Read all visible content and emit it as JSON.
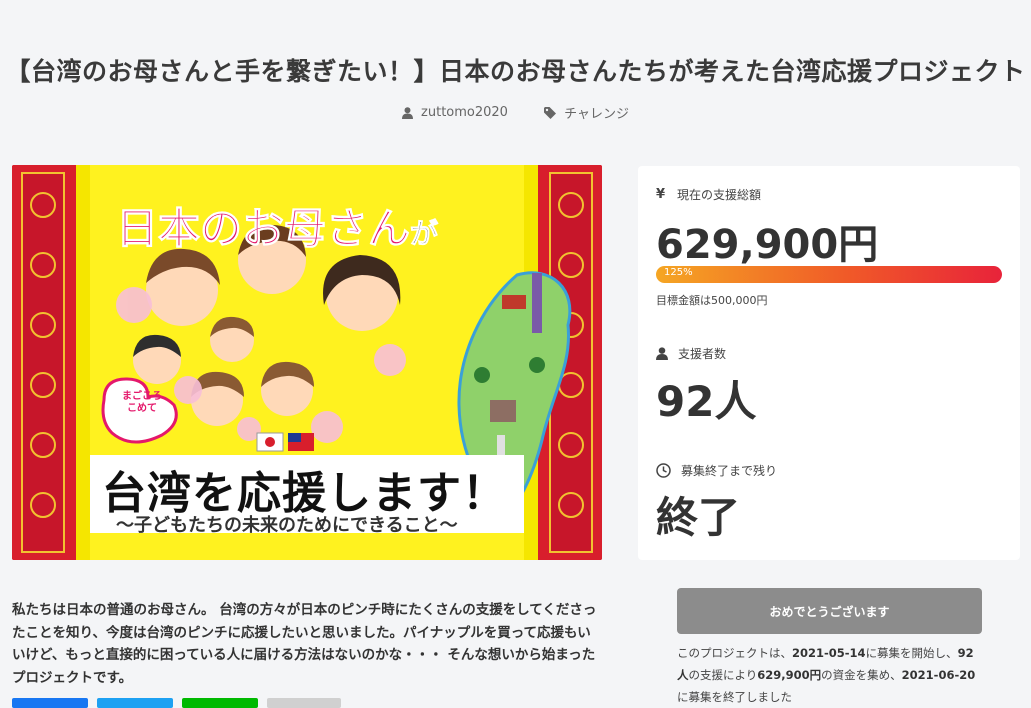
{
  "project": {
    "title": "【台湾のお母さんと手を繋ぎたい！】日本のお母さんたちが考えた台湾応援プロジェクト",
    "author": "zuttomo2020",
    "category": "チャレンジ"
  },
  "hero": {
    "headline_1": "日本のお母さん",
    "headline_1_suffix": "が",
    "stamp_line_1": "まごころ",
    "stamp_line_2": "こめて",
    "headline_2": "台湾を応援します！",
    "tagline": "〜子どもたちの未来のためにできること〜",
    "colors": {
      "frame": "#d81e2c",
      "background": "#fff21f",
      "headline": "#e4186b"
    }
  },
  "stats": {
    "raised_label": "現在の支援総額",
    "raised_value": "629,900円",
    "progress_label": "125%",
    "progress_percent": 125,
    "goal_text": "目標金額は500,000円",
    "supporters_label": "支援者数",
    "supporters_value": "92人",
    "remaining_label": "募集終了まで残り",
    "remaining_value": "終了"
  },
  "description": "私たちは日本の普通のお母さん。 台湾の方々が日本のピンチ時にたくさんの支援をしてくださったことを知り、今度は台湾のピンチに応援したいと思いました。パイナップルを買って応援もいいけど、もっと直接的に困っている人に届ける方法はないのかな・・・ そんな想いから始まったプロジェクトです。",
  "sidebar": {
    "congrats_button": "おめでとうございます",
    "summary_prefix": "このプロジェクトは、",
    "start_date": "2021-05-14",
    "summary_mid1": "に募集を開始し、",
    "supporters": "92人",
    "summary_mid2": "の支援により",
    "amount": "629,900円",
    "summary_mid3": "の資金を集め、",
    "end_date": "2021-06-20",
    "summary_suffix": "に募集を終了しました"
  },
  "colors": {
    "accent_gradient_start": "#f5a623",
    "accent_gradient_end": "#e8233a",
    "button_gray": "#8c8c8c",
    "share_facebook": "#1877f2",
    "share_twitter": "#1da1f2",
    "share_line": "#00b900"
  }
}
